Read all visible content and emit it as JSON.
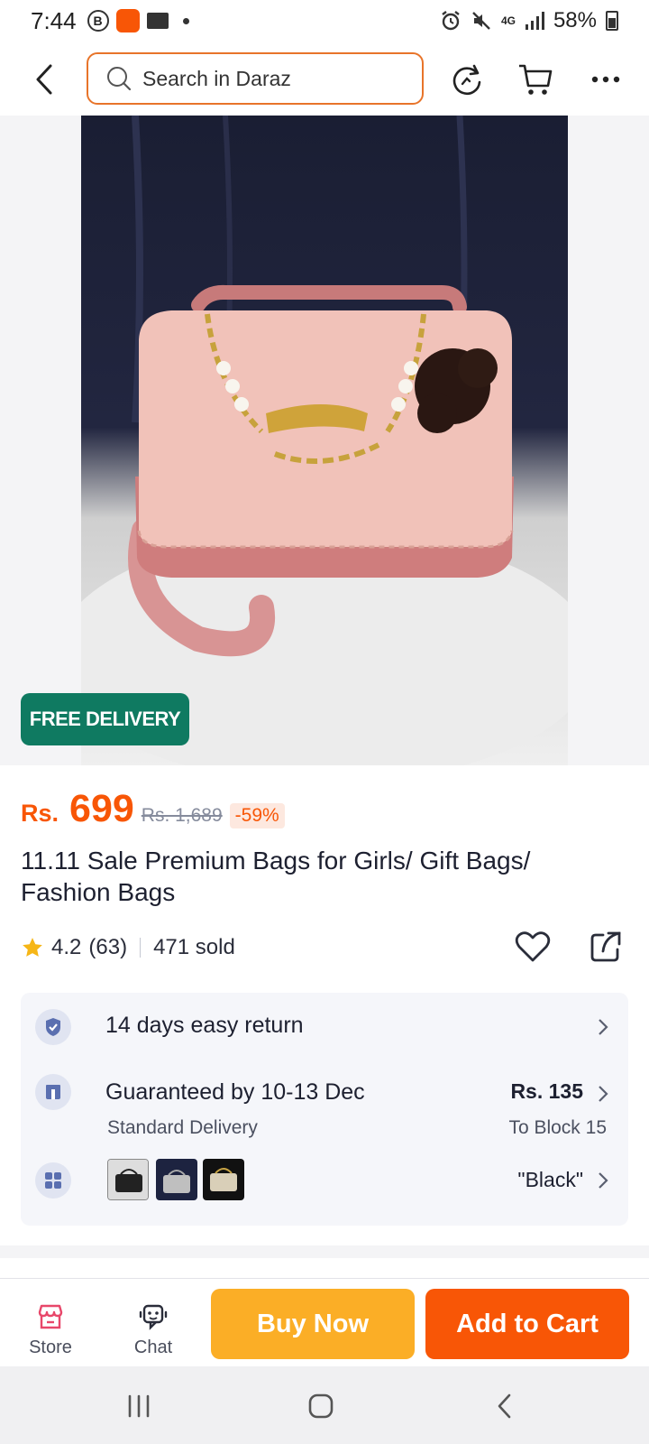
{
  "status_bar": {
    "time": "7:44",
    "network": "4G",
    "battery": "58%",
    "icons": [
      "b-icon",
      "daraz-app-icon",
      "folder-icon",
      "alarm-icon",
      "mute-icon",
      "signal-icon",
      "battery-icon"
    ]
  },
  "header": {
    "search_placeholder": "Search in Daraz",
    "icons": [
      "back-arrow-icon",
      "search-icon",
      "history-icon",
      "cart-icon",
      "more-icon"
    ]
  },
  "product": {
    "badge": "FREE DELIVERY",
    "currency": "Rs.",
    "price": "699",
    "original_price": "Rs. 1,689",
    "discount": "-59%",
    "title": "11.11 Sale Premium Bags for Girls/ Gift Bags/ Fashion Bags",
    "rating": "4.2",
    "reviews": "(63)",
    "sold": "471 sold"
  },
  "services": {
    "return": "14 days easy return",
    "delivery_title": "Guaranteed by 10-13 Dec",
    "delivery_type": "Standard Delivery",
    "delivery_price": "Rs. 135",
    "delivery_location": "To Block 15",
    "variant_selected": "\"Black\""
  },
  "bottom_bar": {
    "store": "Store",
    "chat": "Chat",
    "buy_now": "Buy Now",
    "add_to_cart": "Add to Cart"
  },
  "colors": {
    "brand_orange": "#f85606",
    "buy_now_yellow": "#fbae26",
    "free_delivery_green": "#0f7a61"
  }
}
